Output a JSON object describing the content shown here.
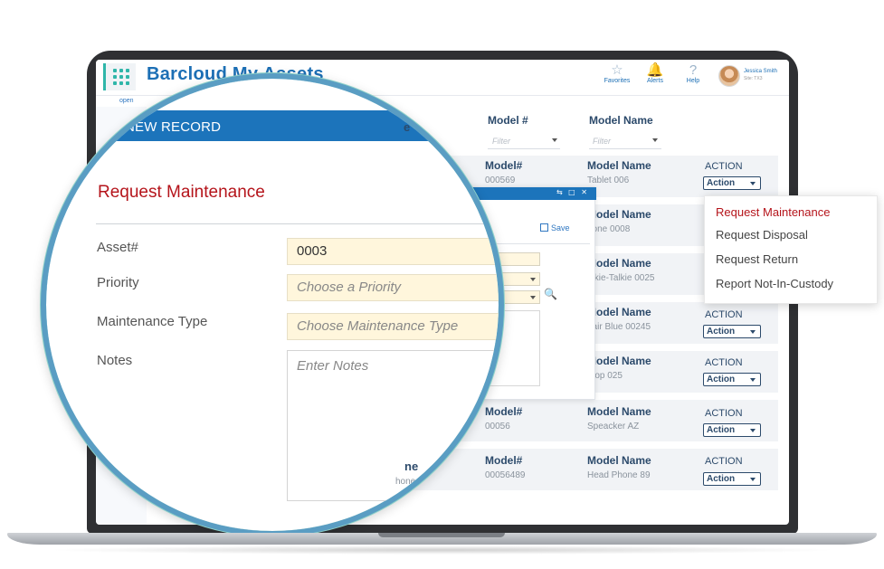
{
  "app": {
    "title": "Barcloud My Assets",
    "open_label": "open"
  },
  "header": {
    "favorites_label": "Favorites",
    "alerts_label": "Alerts",
    "help_label": "Help",
    "user_name": "Jessica Smith",
    "user_site": "Site: TX3"
  },
  "table": {
    "columns": [
      "Model #",
      "Model Name"
    ],
    "filter_placeholder": "Filter",
    "cell_model_label": "Model#",
    "cell_name_label": "Model  Name",
    "action_header": "ACTION",
    "action_select": "Action",
    "rows": [
      {
        "model": "000569",
        "name": "Tablet 006"
      },
      {
        "model": "",
        "name": "hone 0008"
      },
      {
        "model": "",
        "name": "alkie-Talkie 0025"
      },
      {
        "model": "",
        "name": "hair Blue 00245"
      },
      {
        "model": "",
        "name": "ptop 025"
      },
      {
        "model": "00056",
        "name": "Speacker AZ"
      },
      {
        "model": "00056489",
        "name": "Head Phone 89"
      }
    ]
  },
  "action_menu": {
    "items": [
      "Request Maintenance",
      "Request Disposal",
      "Request Return",
      "Report Not-In-Custody"
    ],
    "active_index": 0
  },
  "popup": {
    "save_label": "Save",
    "controls": "⇆ □ ✕"
  },
  "new_record": {
    "bar_title": "NEW RECORD",
    "form_title": "Request Maintenance",
    "fields": {
      "asset_label": "Asset#",
      "asset_value": "0003",
      "priority_label": "Priority",
      "priority_placeholder": "Choose a Priority",
      "maint_type_label": "Maintenance Type",
      "maint_type_placeholder": "Choose Maintenance Type",
      "notes_label": "Notes",
      "notes_placeholder": "Enter Notes"
    },
    "behind_text": {
      "col_e": "e",
      "row_e": "ne",
      "row_e2": "ie",
      "row_val": "hone 89"
    }
  },
  "colors": {
    "brand_blue": "#1c74bb",
    "accent_teal": "#2fb6a9",
    "alert_red": "#b5141b",
    "field_fill": "#fff6dc"
  }
}
